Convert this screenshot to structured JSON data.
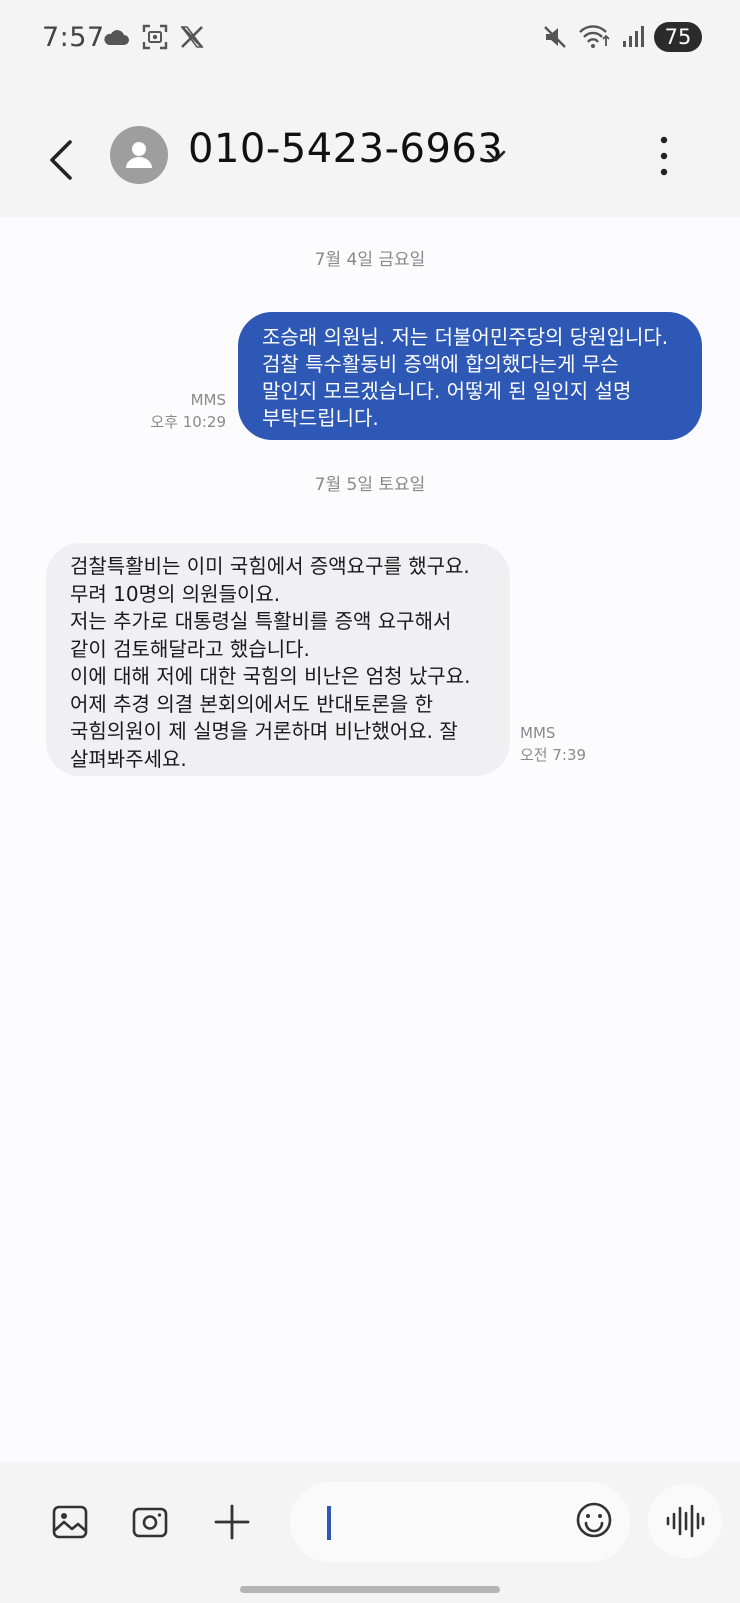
{
  "status_bar": {
    "time": "7:57",
    "left_icons": [
      "cloud-icon",
      "screenshot-icon",
      "x-logo-icon"
    ],
    "right_icons": [
      "mute-icon",
      "wifi-icon",
      "signal-icon"
    ],
    "battery": "75"
  },
  "header": {
    "contact": "010-5423-6963",
    "icons": [
      "back-arrow-icon",
      "person-avatar-icon",
      "chevron-down-icon",
      "more-vertical-icon"
    ]
  },
  "conversation": {
    "messages": [
      {
        "date": "7월 4일 금요일",
        "direction": "outgoing",
        "text": "조승래 의원님. 저는 더불어민주당의 당원입니다.\n검찰 특수활동비 증액에 합의했다는게 무슨\n말인지 모르겠습니다. 어떻게 된 일인지 설명\n부탁드립니다.",
        "type": "MMS",
        "time": "오후 10:29"
      },
      {
        "date": "7월 5일 토요일",
        "direction": "incoming",
        "text": "검찰특활비는 이미 국힘에서 증액요구를 했구요.\n무려 10명의 의원들이요.\n저는 추가로 대통령실 특활비를 증액 요구해서\n같이 검토해달라고 했습니다.\n이에 대해 저에 대한 국힘의 비난은 엄청 났구요.\n어제 추경 의결 본회의에서도 반대토론을 한\n국힘의원이 제 실명을 거론하며 비난했어요. 잘\n살펴봐주세요.",
        "type": "MMS",
        "time": "오전 7:39"
      }
    ]
  },
  "input_bar": {
    "placeholder": "",
    "icons": [
      "gallery-icon",
      "camera-icon",
      "plus-icon",
      "emoji-icon",
      "voice-wave-icon"
    ]
  },
  "colors": {
    "outgoing_bubble": "#2d58b6",
    "incoming_bubble": "#f0f0f2",
    "chrome_background": "#f4f4f4"
  }
}
